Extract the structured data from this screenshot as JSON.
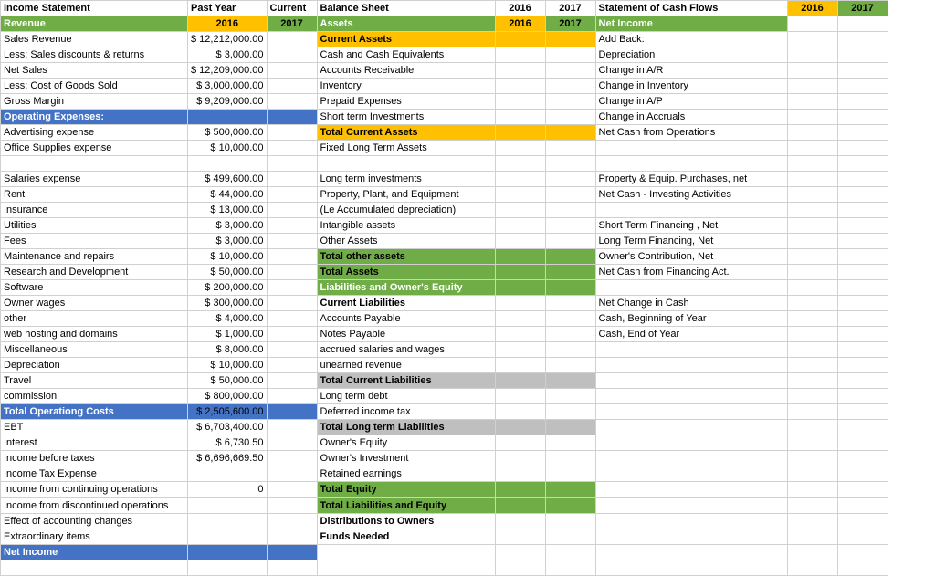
{
  "incomeStatement": {
    "title": "Income Statement",
    "col_past_year": "Past Year",
    "col_current": "Current",
    "col_2016": "2016",
    "col_2017": "2017",
    "rows": [
      {
        "label": "Revenue",
        "type": "revenue",
        "val2016": "",
        "val2017": ""
      },
      {
        "label": "Sales Revenue",
        "type": "normal",
        "val2016": "$ 12,212,000.00",
        "val2017": ""
      },
      {
        "label": "Less: Sales discounts & returns",
        "type": "normal",
        "val2016": "$       3,000.00",
        "val2017": ""
      },
      {
        "label": "Net Sales",
        "type": "normal",
        "val2016": "$ 12,209,000.00",
        "val2017": ""
      },
      {
        "label": "Less: Cost of Goods Sold",
        "type": "normal",
        "val2016": "$  3,000,000.00",
        "val2017": ""
      },
      {
        "label": "Gross Margin",
        "type": "normal",
        "val2016": "$  9,209,000.00",
        "val2017": ""
      },
      {
        "label": "Operating Expenses:",
        "type": "opex",
        "val2016": "",
        "val2017": ""
      },
      {
        "label": "Advertising expense",
        "type": "normal",
        "val2016": "$      500,000.00",
        "val2017": ""
      },
      {
        "label": "Office Supplies expense",
        "type": "normal",
        "val2016": "$        10,000.00",
        "val2017": ""
      },
      {
        "label": "",
        "type": "normal",
        "val2016": "",
        "val2017": ""
      },
      {
        "label": "Salaries expense",
        "type": "normal",
        "val2016": "$      499,600.00",
        "val2017": ""
      },
      {
        "label": "Rent",
        "type": "normal",
        "val2016": "$        44,000.00",
        "val2017": ""
      },
      {
        "label": "Insurance",
        "type": "normal",
        "val2016": "$        13,000.00",
        "val2017": ""
      },
      {
        "label": "Utilities",
        "type": "normal",
        "val2016": "$          3,000.00",
        "val2017": ""
      },
      {
        "label": "Fees",
        "type": "normal",
        "val2016": "$          3,000.00",
        "val2017": ""
      },
      {
        "label": "Maintenance and repairs",
        "type": "normal",
        "val2016": "$        10,000.00",
        "val2017": ""
      },
      {
        "label": "Research and Development",
        "type": "normal",
        "val2016": "$        50,000.00",
        "val2017": ""
      },
      {
        "label": "Software",
        "type": "normal",
        "val2016": "$      200,000.00",
        "val2017": ""
      },
      {
        "label": "Owner wages",
        "type": "normal",
        "val2016": "$      300,000.00",
        "val2017": ""
      },
      {
        "label": "other",
        "type": "normal",
        "val2016": "$          4,000.00",
        "val2017": ""
      },
      {
        "label": "web hosting and domains",
        "type": "normal",
        "val2016": "$          1,000.00",
        "val2017": ""
      },
      {
        "label": "Miscellaneous",
        "type": "normal",
        "val2016": "$          8,000.00",
        "val2017": ""
      },
      {
        "label": "Depreciation",
        "type": "normal",
        "val2016": "$        10,000.00",
        "val2017": ""
      },
      {
        "label": "Travel",
        "type": "normal",
        "val2016": "$        50,000.00",
        "val2017": ""
      },
      {
        "label": "commission",
        "type": "normal",
        "val2016": "$      800,000.00",
        "val2017": ""
      },
      {
        "label": "Total Operationg Costs",
        "type": "total-op",
        "val2016": "$  2,505,600.00",
        "val2017": ""
      },
      {
        "label": "EBT",
        "type": "normal",
        "val2016": "$  6,703,400.00",
        "val2017": ""
      },
      {
        "label": "Interest",
        "type": "normal",
        "val2016": "$          6,730.50",
        "val2017": ""
      },
      {
        "label": "Income before taxes",
        "type": "normal",
        "val2016": "$  6,696,669.50",
        "val2017": ""
      },
      {
        "label": "Income Tax Expense",
        "type": "normal",
        "val2016": "",
        "val2017": ""
      },
      {
        "label": "Income from continuing operations",
        "type": "normal",
        "val2016": "0",
        "val2017": ""
      },
      {
        "label": "Income from discontinued operations",
        "type": "normal",
        "val2016": "",
        "val2017": ""
      },
      {
        "label": "Effect of accounting changes",
        "type": "normal",
        "val2016": "",
        "val2017": ""
      },
      {
        "label": "Extraordinary items",
        "type": "normal",
        "val2016": "",
        "val2017": ""
      },
      {
        "label": "Net Income",
        "type": "net-income",
        "val2016": "",
        "val2017": ""
      }
    ]
  },
  "balanceSheet": {
    "title": "Balance Sheet",
    "col_2016": "2016",
    "col_2017": "2017",
    "rows": [
      {
        "label": "Assets",
        "type": "assets"
      },
      {
        "label": "Current Assets",
        "type": "current-assets"
      },
      {
        "label": "Cash and Cash Equivalents",
        "type": "normal"
      },
      {
        "label": "Accounts Receivable",
        "type": "normal"
      },
      {
        "label": "Inventory",
        "type": "normal"
      },
      {
        "label": "Prepaid Expenses",
        "type": "normal"
      },
      {
        "label": "Short term Investments",
        "type": "normal"
      },
      {
        "label": "Total Current Assets",
        "type": "total-current-assets"
      },
      {
        "label": "Fixed Long Term Assets",
        "type": "normal"
      },
      {
        "label": "",
        "type": "normal"
      },
      {
        "label": "Long term investments",
        "type": "normal"
      },
      {
        "label": "Property, Plant, and Equipment",
        "type": "normal"
      },
      {
        "label": "(Le Accumulated depreciation)",
        "type": "normal"
      },
      {
        "label": "Intangible assets",
        "type": "normal"
      },
      {
        "label": "Other Assets",
        "type": "normal"
      },
      {
        "label": "Total other assets",
        "type": "total-other"
      },
      {
        "label": "Total Assets",
        "type": "total-assets"
      },
      {
        "label": "Liabilities and Owner's Equity",
        "type": "liabilities"
      },
      {
        "label": "Current Liabilities",
        "type": "current-liab"
      },
      {
        "label": "Accounts Payable",
        "type": "normal"
      },
      {
        "label": "Notes Payable",
        "type": "normal"
      },
      {
        "label": "accrued salaries and wages",
        "type": "normal"
      },
      {
        "label": "unearned revenue",
        "type": "normal"
      },
      {
        "label": "Total Current Liabilities",
        "type": "total-current-liab"
      },
      {
        "label": "Long term debt",
        "type": "normal"
      },
      {
        "label": "Deferred income tax",
        "type": "normal"
      },
      {
        "label": "Total Long term Liabilities",
        "type": "total-long-liab"
      },
      {
        "label": "Owner's Equity",
        "type": "normal"
      },
      {
        "label": "Owner's Investment",
        "type": "normal"
      },
      {
        "label": "Retained earnings",
        "type": "normal"
      },
      {
        "label": "Total Equity",
        "type": "total-equity"
      },
      {
        "label": "Total  Liabilities and Equity",
        "type": "total-liab-equity"
      },
      {
        "label": "Distributions to Owners",
        "type": "dist"
      },
      {
        "label": "Funds Needed",
        "type": "dist"
      },
      {
        "label": "",
        "type": "normal"
      },
      {
        "label": "",
        "type": "normal"
      }
    ]
  },
  "cashFlow": {
    "title": "Statement of Cash Flows",
    "col_2016": "2016",
    "col_2017": "2017",
    "rows": [
      {
        "label": "Net Income",
        "type": "net-income"
      },
      {
        "label": "Add Back:",
        "type": "normal"
      },
      {
        "label": "Depreciation",
        "type": "normal"
      },
      {
        "label": "Change in A/R",
        "type": "normal"
      },
      {
        "label": "Change in Inventory",
        "type": "normal"
      },
      {
        "label": "Change in A/P",
        "type": "normal"
      },
      {
        "label": "Change in Accruals",
        "type": "normal"
      },
      {
        "label": "Net Cash from Operations",
        "type": "normal"
      },
      {
        "label": "",
        "type": "normal"
      },
      {
        "label": "",
        "type": "normal"
      },
      {
        "label": "Property & Equip. Purchases, net",
        "type": "normal"
      },
      {
        "label": "Net Cash - Investing Activities",
        "type": "normal"
      },
      {
        "label": "",
        "type": "normal"
      },
      {
        "label": "Short Term Financing , Net",
        "type": "normal"
      },
      {
        "label": "Long Term Financing, Net",
        "type": "normal"
      },
      {
        "label": "Owner's Contribution, Net",
        "type": "normal"
      },
      {
        "label": "Net Cash from Financing Act.",
        "type": "normal"
      },
      {
        "label": "",
        "type": "normal"
      },
      {
        "label": "Net Change in Cash",
        "type": "normal"
      },
      {
        "label": "Cash, Beginning of Year",
        "type": "normal"
      },
      {
        "label": "Cash, End of Year",
        "type": "normal"
      },
      {
        "label": "",
        "type": "normal"
      },
      {
        "label": "",
        "type": "normal"
      },
      {
        "label": "",
        "type": "normal"
      },
      {
        "label": "",
        "type": "normal"
      },
      {
        "label": "",
        "type": "normal"
      },
      {
        "label": "",
        "type": "normal"
      },
      {
        "label": "",
        "type": "normal"
      },
      {
        "label": "",
        "type": "normal"
      },
      {
        "label": "",
        "type": "normal"
      },
      {
        "label": "",
        "type": "normal"
      },
      {
        "label": "",
        "type": "normal"
      },
      {
        "label": "",
        "type": "normal"
      },
      {
        "label": "",
        "type": "normal"
      },
      {
        "label": "",
        "type": "normal"
      }
    ]
  }
}
